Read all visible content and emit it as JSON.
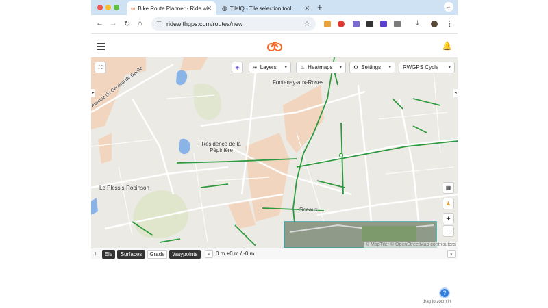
{
  "browser": {
    "tabs": [
      {
        "label": "Bike Route Planner - Ride wi",
        "active": true
      },
      {
        "label": "TileIQ - Tile selection tool",
        "active": false
      }
    ],
    "url": "ridewithgps.com/routes/new"
  },
  "colors": {
    "accent": "#f26b2a",
    "route": "#2e9a3e",
    "tabbar": "#cfe2f4"
  },
  "map": {
    "places": [
      "Fontenay-aux-Roses",
      "Résidence de la Pépinière",
      "Le Plessis-Robinson",
      "Sceaux",
      "Avenue du Général de Gaulle"
    ],
    "controls": {
      "layers": "Layers",
      "heatmaps": "Heatmaps",
      "settings": "Settings",
      "routing": "RWGPS Cycle",
      "zoom_in": "+",
      "zoom_out": "−"
    },
    "attribution": "© MapTiler © OpenStreetMap contributors"
  },
  "elevation": {
    "tabs": [
      "Ele",
      "Surfaces",
      "Grade",
      "Waypoints"
    ],
    "stats": "0 m +0 m / -0 m"
  },
  "footer": {
    "hint": "drag to zoom in"
  }
}
